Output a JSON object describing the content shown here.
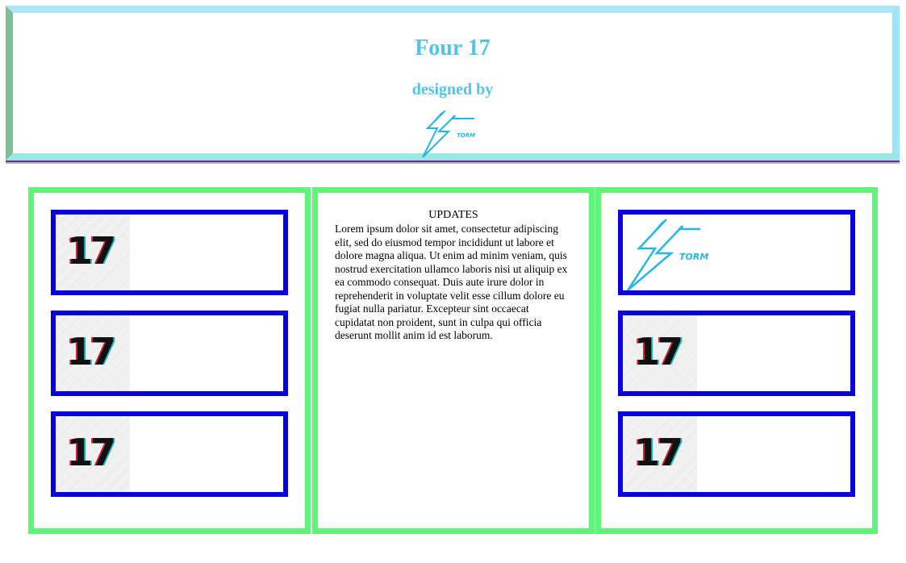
{
  "header": {
    "title": "Four 17",
    "subtitle": "designed by",
    "logo_text": "TORM",
    "logo_icon": "lightning-bolt-icon"
  },
  "left_panel": {
    "cards": [
      {
        "image_text": "17"
      },
      {
        "image_text": "17"
      },
      {
        "image_text": "17"
      }
    ]
  },
  "middle_panel": {
    "title": "UPDATES",
    "body": "Lorem ipsum dolor sit amet, consectetur adipiscing elit, sed do eiusmod tempor incididunt ut labore et dolore magna aliqua. Ut enim ad minim veniam, quis nostrud exercitation ullamco laboris nisi ut aliquip ex ea commodo consequat. Duis aute irure dolor in reprehenderit in voluptate velit esse cillum dolore eu fugiat nulla pariatur. Excepteur sint occaecat cupidatat non proident, sunt in culpa qui officia deserunt mollit anim id est laborum."
  },
  "right_panel": {
    "cards": [
      {
        "logo_text": "TORM"
      },
      {
        "image_text": "17"
      },
      {
        "image_text": "17"
      }
    ]
  },
  "colors": {
    "accent_blue": "#50c5eb",
    "panel_border": "#5ff576",
    "card_border": "#0a00de"
  }
}
